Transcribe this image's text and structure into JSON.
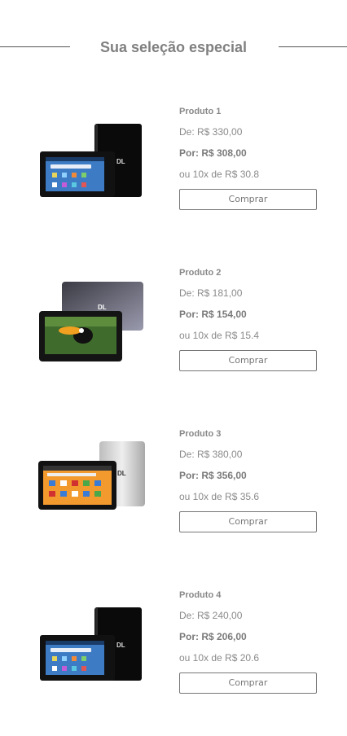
{
  "section": {
    "title": "Sua seleção especial"
  },
  "products": [
    {
      "name": "Produto 1",
      "old_price": "De: R$ 330,00",
      "price": "Por: R$ 308,00",
      "installments": "ou 10x de R$ 30.8",
      "buy_label": "Comprar",
      "image": "tablet-black-image",
      "logo": "DL"
    },
    {
      "name": "Produto 2",
      "old_price": "De: R$ 181,00",
      "price": "Por: R$ 154,00",
      "installments": "ou 10x de R$ 15.4",
      "buy_label": "Comprar",
      "image": "tablet-gray-toucan-image",
      "logo": "DL"
    },
    {
      "name": "Produto 3",
      "old_price": "De: R$ 380,00",
      "price": "Por: R$ 356,00",
      "installments": "ou 10x de R$ 35.6",
      "buy_label": "Comprar",
      "image": "tablet-silver-image",
      "logo": "DL"
    },
    {
      "name": "Produto 4",
      "old_price": "De: R$ 240,00",
      "price": "Por: R$ 206,00",
      "installments": "ou 10x de R$ 20.6",
      "buy_label": "Comprar",
      "image": "tablet-black-image",
      "logo": "DL"
    }
  ]
}
